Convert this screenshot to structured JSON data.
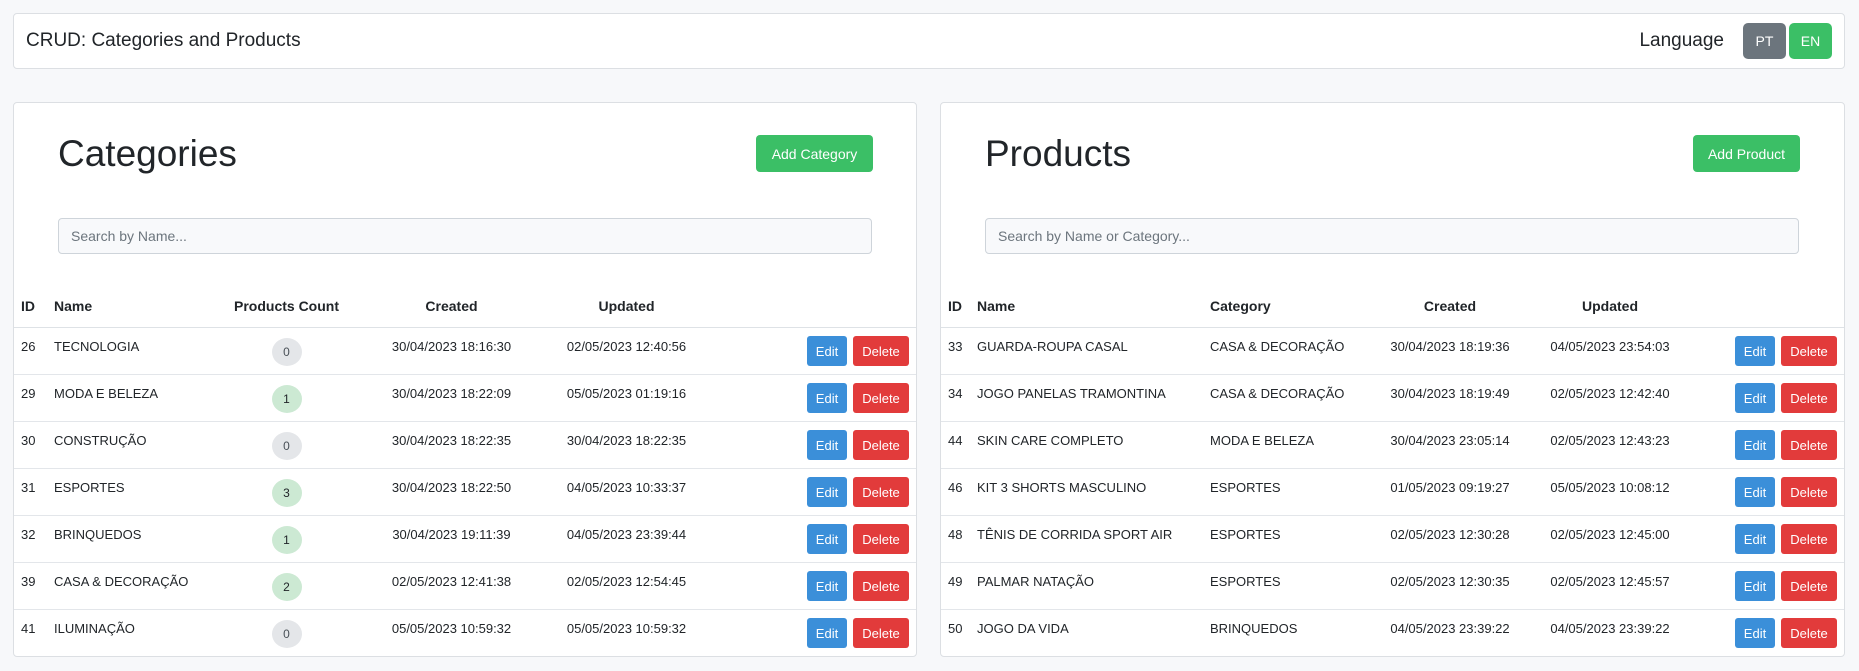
{
  "navbar": {
    "brand": "CRUD: Categories and Products",
    "language_label": "Language",
    "lang_pt": "PT",
    "lang_en": "EN"
  },
  "categories": {
    "title": "Categories",
    "add_label": "Add Category",
    "search_placeholder": "Search by Name...",
    "columns": [
      "ID",
      "Name",
      "Products Count",
      "Created",
      "Updated"
    ],
    "rows": [
      {
        "id": "26",
        "name": "TECNOLOGIA",
        "count": "0",
        "created": "30/04/2023 18:16:30",
        "updated": "02/05/2023 12:40:56"
      },
      {
        "id": "29",
        "name": "MODA E BELEZA",
        "count": "1",
        "created": "30/04/2023 18:22:09",
        "updated": "05/05/2023 01:19:16"
      },
      {
        "id": "30",
        "name": "CONSTRUÇÃO",
        "count": "0",
        "created": "30/04/2023 18:22:35",
        "updated": "30/04/2023 18:22:35"
      },
      {
        "id": "31",
        "name": "ESPORTES",
        "count": "3",
        "created": "30/04/2023 18:22:50",
        "updated": "04/05/2023 10:33:37"
      },
      {
        "id": "32",
        "name": "BRINQUEDOS",
        "count": "1",
        "created": "30/04/2023 19:11:39",
        "updated": "04/05/2023 23:39:44"
      },
      {
        "id": "39",
        "name": "CASA & DECORAÇÃO",
        "count": "2",
        "created": "02/05/2023 12:41:38",
        "updated": "02/05/2023 12:54:45"
      },
      {
        "id": "41",
        "name": "ILUMINAÇÃO",
        "count": "0",
        "created": "05/05/2023 10:59:32",
        "updated": "05/05/2023 10:59:32"
      }
    ],
    "edit_label": "Edit",
    "delete_label": "Delete"
  },
  "products": {
    "title": "Products",
    "add_label": "Add Product",
    "search_placeholder": "Search by Name or Category...",
    "columns": [
      "ID",
      "Name",
      "Category",
      "Created",
      "Updated"
    ],
    "rows": [
      {
        "id": "33",
        "name": "GUARDA-ROUPA CASAL",
        "category": "CASA & DECORAÇÃO",
        "created": "30/04/2023 18:19:36",
        "updated": "04/05/2023 23:54:03"
      },
      {
        "id": "34",
        "name": "JOGO PANELAS TRAMONTINA",
        "category": "CASA & DECORAÇÃO",
        "created": "30/04/2023 18:19:49",
        "updated": "02/05/2023 12:42:40"
      },
      {
        "id": "44",
        "name": "SKIN CARE COMPLETO",
        "category": "MODA E BELEZA",
        "created": "30/04/2023 23:05:14",
        "updated": "02/05/2023 12:43:23"
      },
      {
        "id": "46",
        "name": "KIT 3 SHORTS MASCULINO",
        "category": "ESPORTES",
        "created": "01/05/2023 09:19:27",
        "updated": "05/05/2023 10:08:12"
      },
      {
        "id": "48",
        "name": "TÊNIS DE CORRIDA SPORT AIR",
        "category": "ESPORTES",
        "created": "02/05/2023 12:30:28",
        "updated": "02/05/2023 12:45:00"
      },
      {
        "id": "49",
        "name": "PALMAR NATAÇÃO",
        "category": "ESPORTES",
        "created": "02/05/2023 12:30:35",
        "updated": "02/05/2023 12:45:57"
      },
      {
        "id": "50",
        "name": "JOGO DA VIDA",
        "category": "BRINQUEDOS",
        "created": "04/05/2023 23:39:22",
        "updated": "04/05/2023 23:39:22"
      }
    ],
    "edit_label": "Edit",
    "delete_label": "Delete"
  },
  "colors": {
    "success": "#3bbf66",
    "primary": "#3b8fd9",
    "danger": "#e23b3b",
    "secondary": "#6c757d"
  }
}
